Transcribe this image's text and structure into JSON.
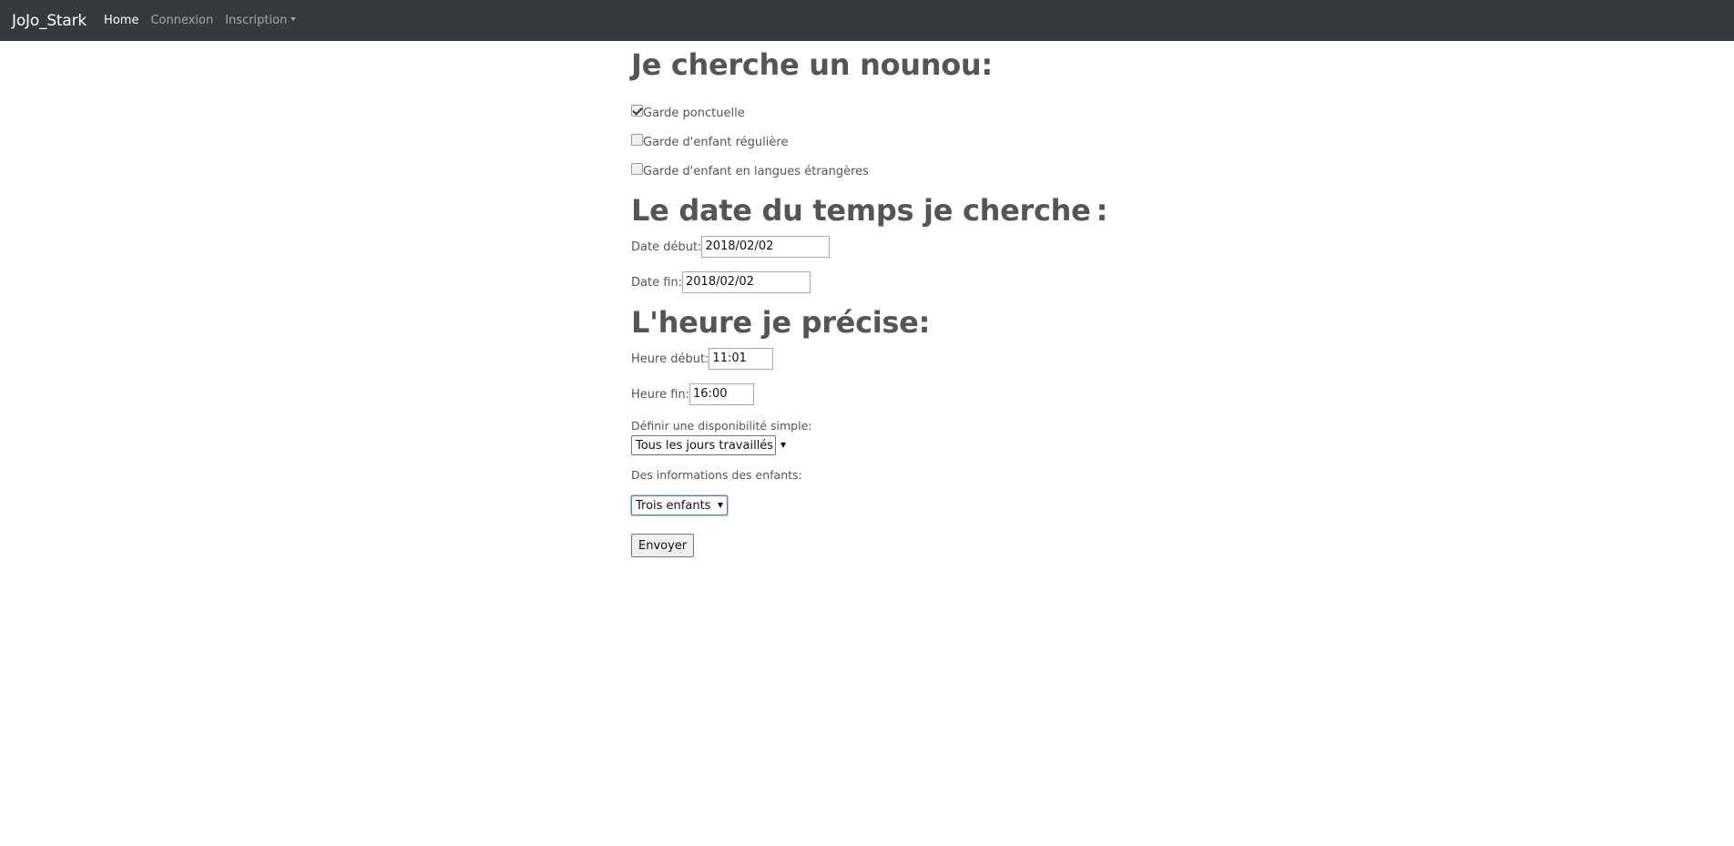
{
  "navbar": {
    "brand": "JoJo_Stark",
    "home": "Home",
    "connexion": "Connexion",
    "inscription": "Inscription"
  },
  "section1": {
    "title": "Je cherche un nounou:",
    "options": [
      {
        "label": "Garde ponctuelle",
        "checked": true
      },
      {
        "label": "Garde d'enfant régulière",
        "checked": false
      },
      {
        "label": "Garde d'enfant en langues étrangères",
        "checked": false
      }
    ]
  },
  "section2": {
    "title": "Le date du temps je cherche :",
    "date_start_label": "Date début:",
    "date_start_value": "2018/02/02",
    "date_end_label": "Date fin:",
    "date_end_value": "2018/02/02"
  },
  "section3": {
    "title": "L'heure je précise:",
    "hour_start_label": "Heure début:",
    "hour_start_value": "11:01",
    "hour_end_label": "Heure fin:",
    "hour_end_value": "16:00",
    "availability_label": "Définir une disponibilité simple:",
    "availability_selected": "Tous les jours travaillés",
    "children_label": "Des informations des enfants:",
    "children_selected": "Trois enfants",
    "submit_label": "Envoyer"
  }
}
